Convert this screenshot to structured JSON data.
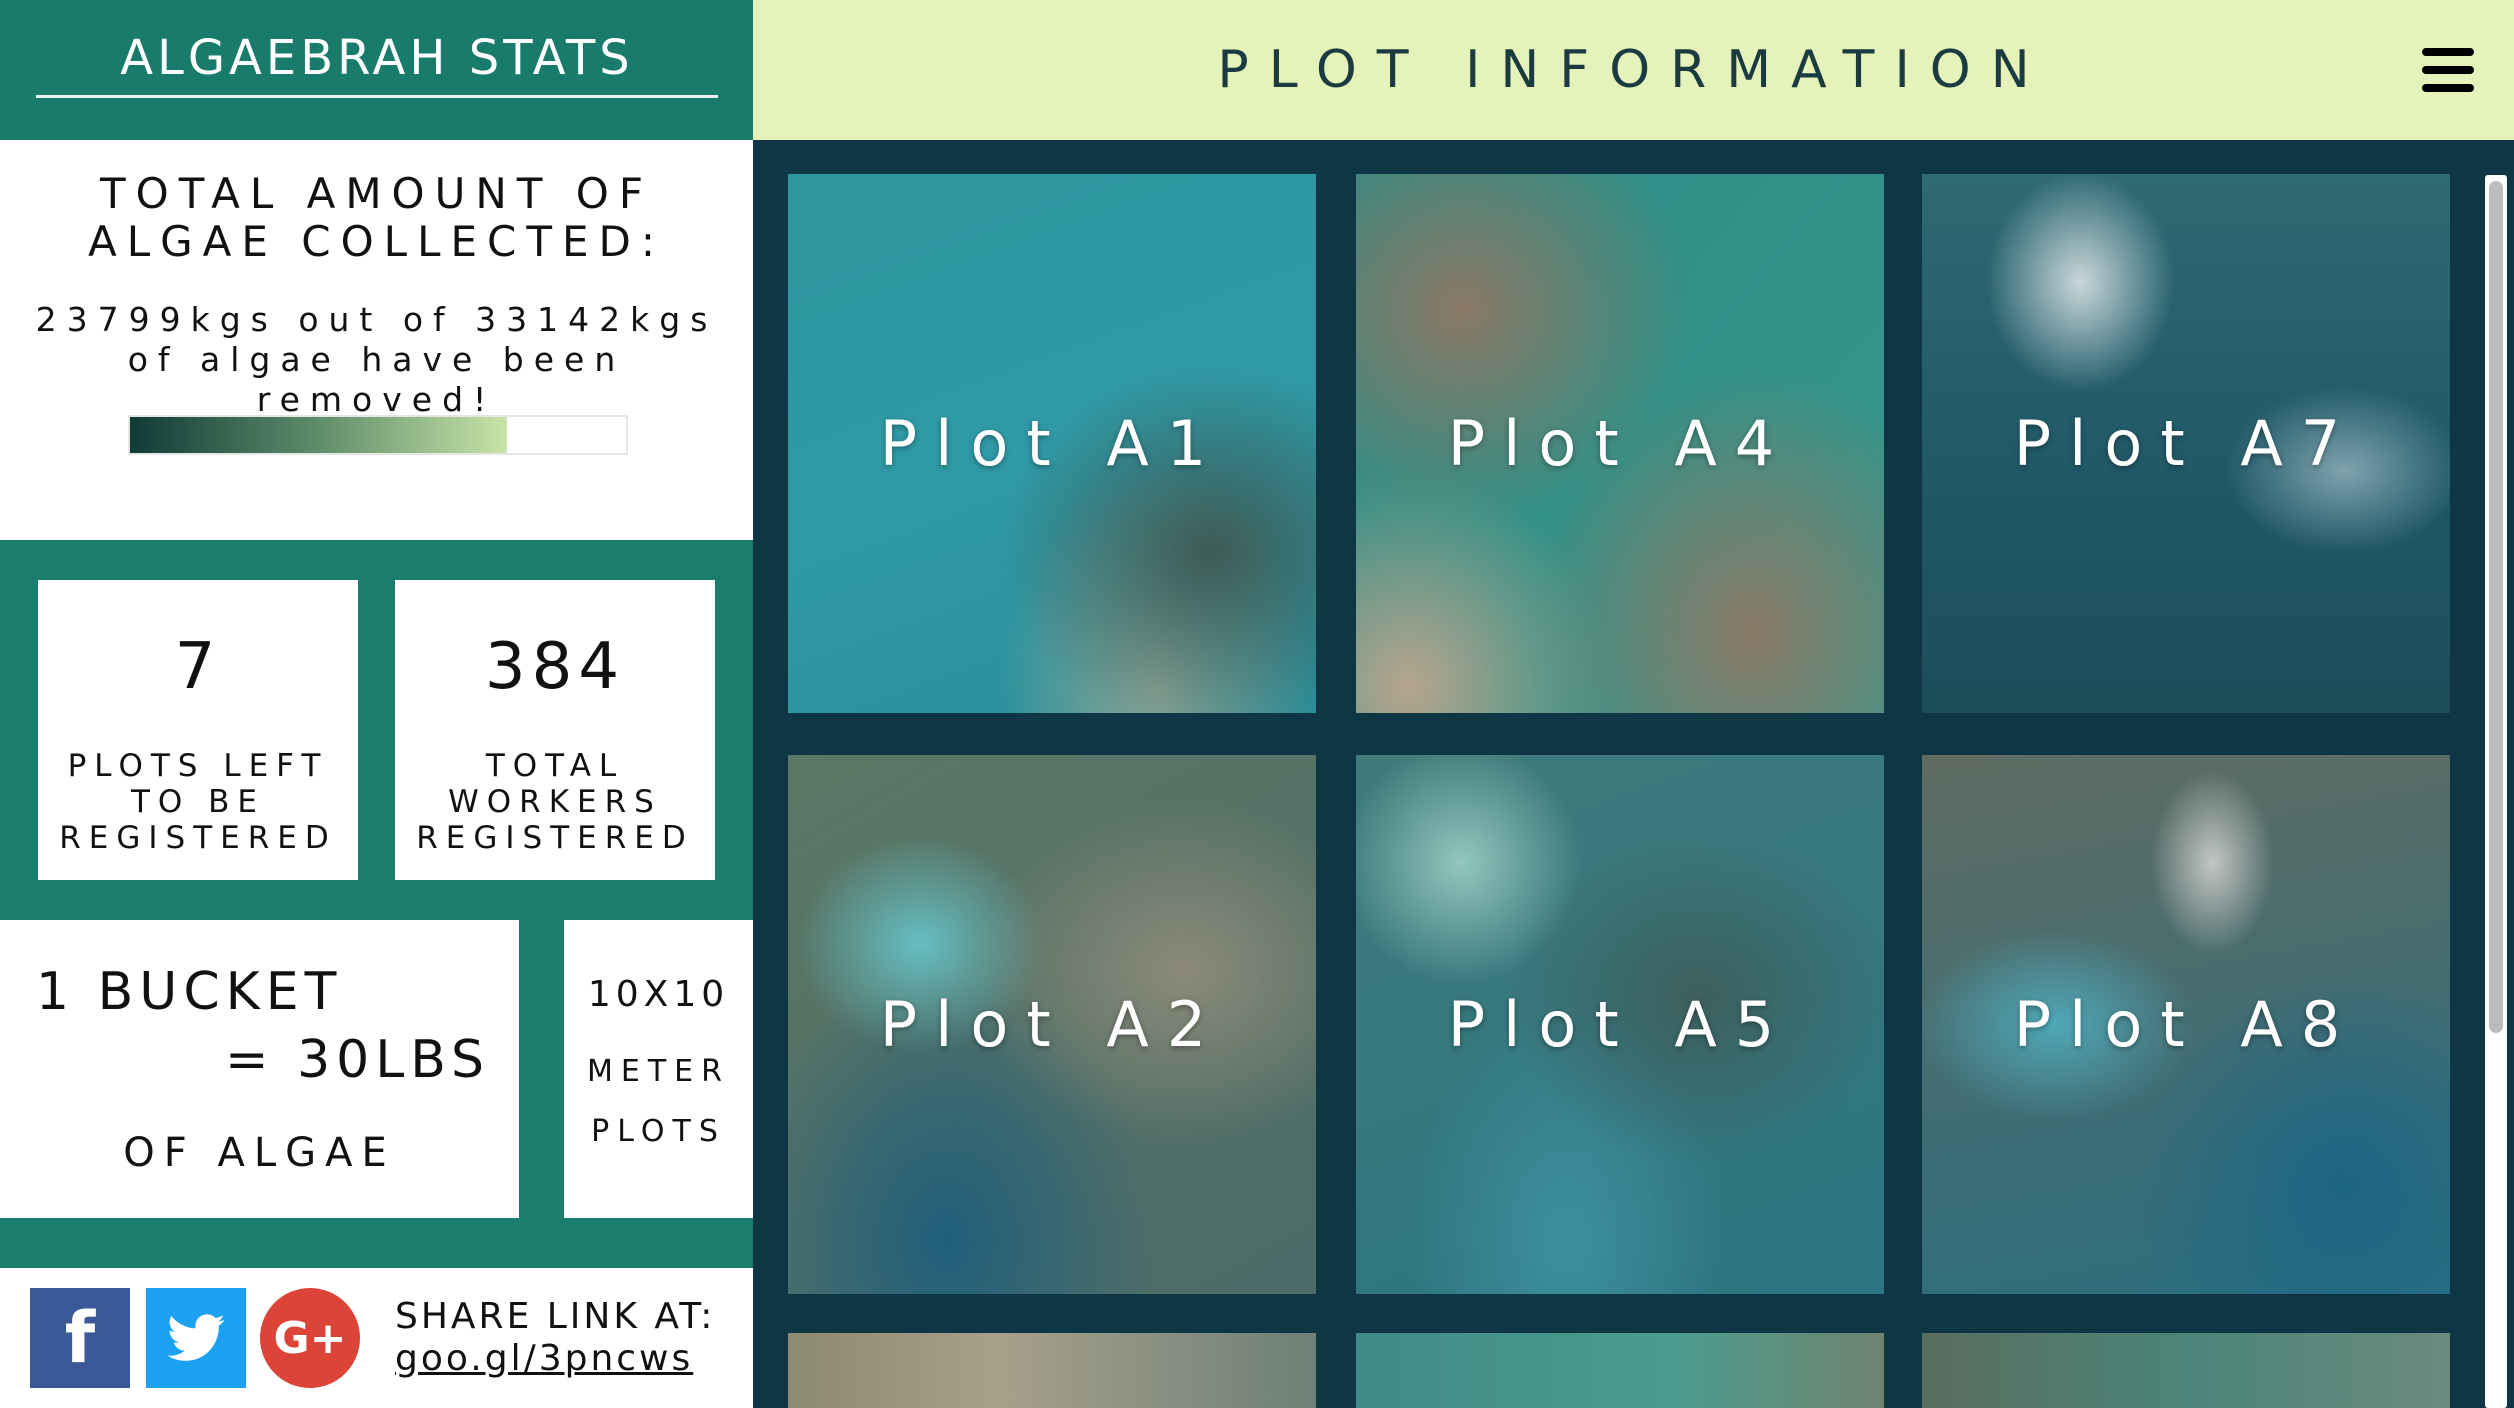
{
  "sidebar": {
    "title": "ALGAEBRAH STATS",
    "algae": {
      "heading": "TOTAL AMOUNT OF ALGAE COLLECTED:",
      "summary": "23799kgs out of 33142kgs of algae have been removed!",
      "collected_kg": 23799,
      "total_kg": 33142,
      "progress_fraction": 0.76
    },
    "stats": {
      "plots_left": {
        "value": "7",
        "label": "PLOTS LEFT TO BE REGISTERED"
      },
      "workers": {
        "value": "384",
        "label": "TOTAL WORKERS REGISTERED"
      }
    },
    "bucket": {
      "line1": "1 BUCKET",
      "line2": "= 30LBS",
      "line3": "OF ALGAE"
    },
    "meter": {
      "size": "10X10",
      "unit": "METER",
      "plots": "PLOTS"
    },
    "share": {
      "label": "SHARE LINK AT:",
      "link": "goo.gl/3pncws",
      "facebook_icon": "facebook-icon",
      "twitter_icon": "twitter-icon",
      "google_plus_icon": "google-plus-icon"
    }
  },
  "header": {
    "title": "PLOT INFORMATION",
    "menu_icon": "hamburger-menu-icon"
  },
  "plots": [
    {
      "label": "Plot A1"
    },
    {
      "label": "Plot A4"
    },
    {
      "label": "Plot A7"
    },
    {
      "label": "Plot A2"
    },
    {
      "label": "Plot A5"
    },
    {
      "label": "Plot A8"
    }
  ],
  "colors": {
    "sidebar_teal": "#1a7d6d",
    "main_dark": "#0f3645",
    "header_lime": "#e5f2b9",
    "facebook": "#3b5998",
    "twitter": "#1da1f2",
    "google_plus": "#db4437"
  }
}
